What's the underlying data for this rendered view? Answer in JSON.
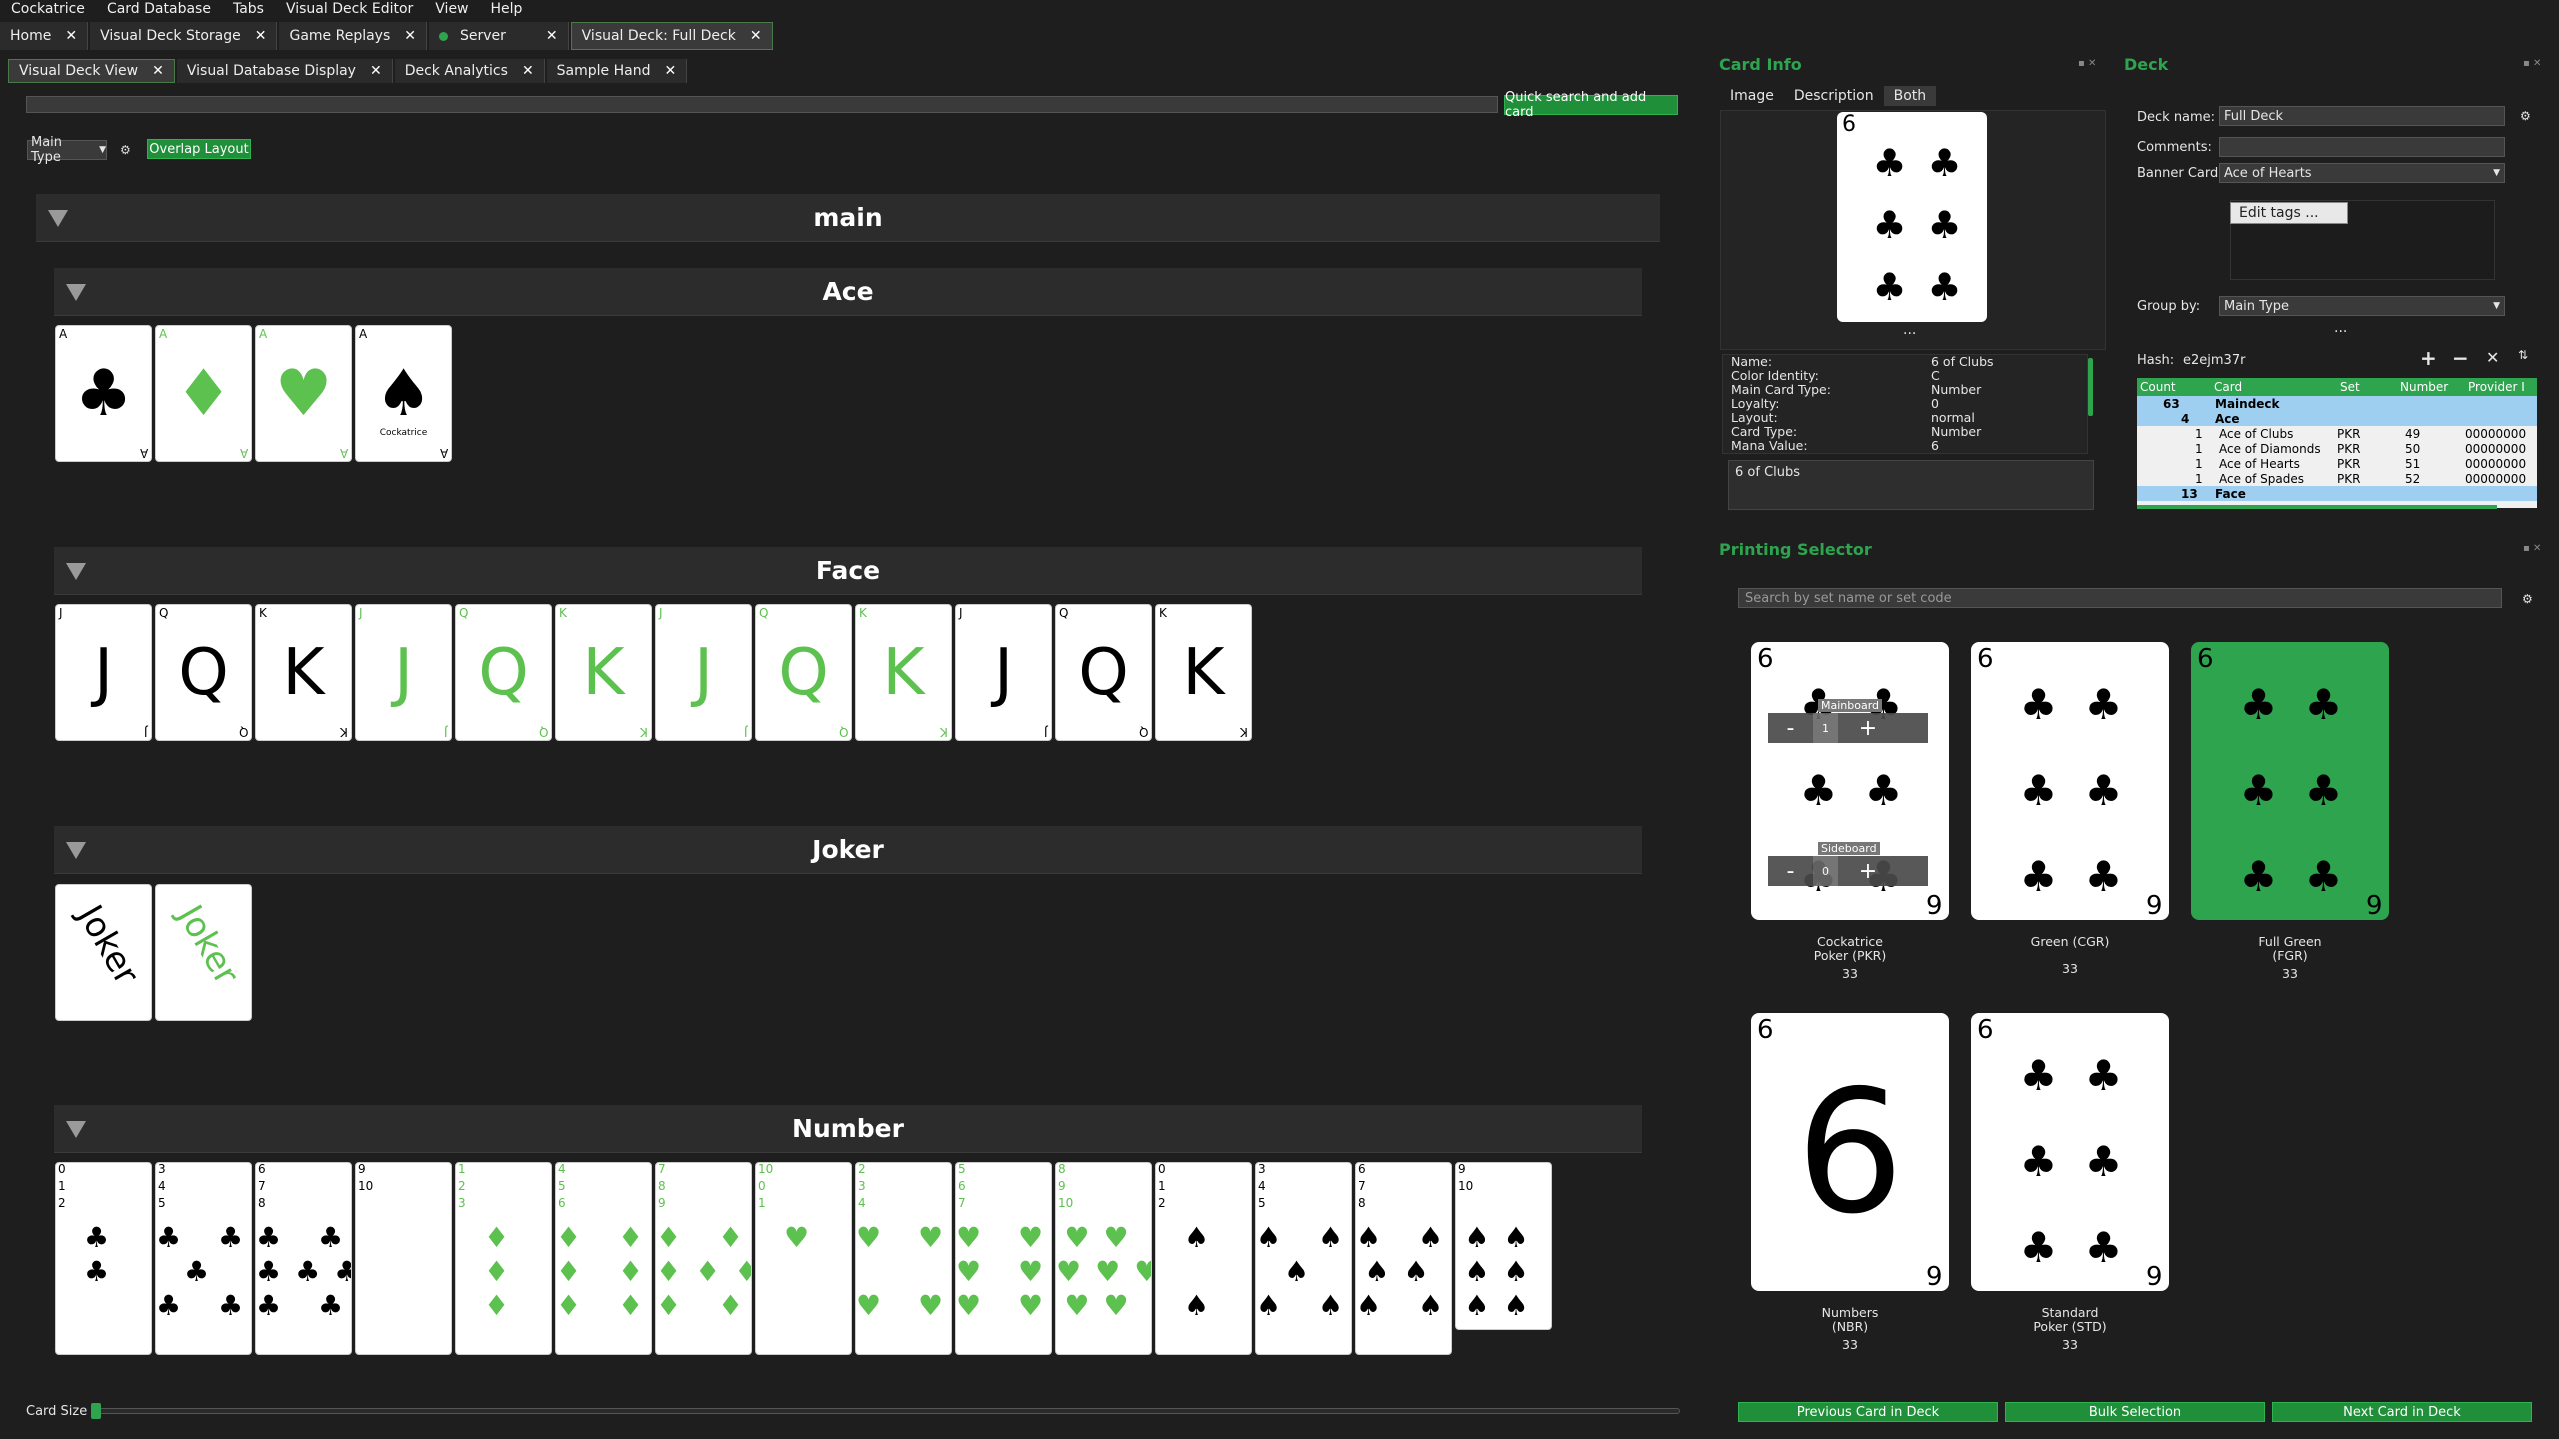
{
  "menu": [
    "Cockatrice",
    "Card Database",
    "Tabs",
    "Visual Deck Editor",
    "View",
    "Help"
  ],
  "tabs": [
    {
      "label": "Home"
    },
    {
      "label": "Visual Deck Storage"
    },
    {
      "label": "Game Replays"
    },
    {
      "label": "Server"
    },
    {
      "label": "Visual Deck: Full Deck"
    }
  ],
  "subtabs": [
    "Visual Deck View",
    "Visual Database Display",
    "Deck Analytics",
    "Sample Hand"
  ],
  "toolbar": {
    "quick_search": "Quick search and add card",
    "main_type": "Main Type",
    "overlap": "Overlap Layout"
  },
  "groups": {
    "main": "main",
    "ace": "Ace",
    "face": "Face",
    "joker": "Joker",
    "number": "Number"
  },
  "ace_cards": [
    {
      "rank": "A",
      "suit": "♣",
      "green": false
    },
    {
      "rank": "A",
      "suit": "♦",
      "green": true
    },
    {
      "rank": "A",
      "suit": "♥",
      "green": true
    },
    {
      "rank": "A",
      "suit": "♠",
      "green": false,
      "brand": "Cockatrice"
    }
  ],
  "face_cards": [
    {
      "r": "J",
      "g": false
    },
    {
      "r": "Q",
      "g": false
    },
    {
      "r": "K",
      "g": false
    },
    {
      "r": "J",
      "g": true
    },
    {
      "r": "Q",
      "g": true
    },
    {
      "r": "K",
      "g": true
    },
    {
      "r": "J",
      "g": true
    },
    {
      "r": "Q",
      "g": true
    },
    {
      "r": "K",
      "g": true
    },
    {
      "r": "J",
      "g": false
    },
    {
      "r": "Q",
      "g": false
    },
    {
      "r": "K",
      "g": false
    }
  ],
  "joker_cards": [
    {
      "label": "Joker",
      "g": false
    },
    {
      "label": "Joker",
      "g": true
    }
  ],
  "number_cards": [
    {
      "ranks": [
        "0",
        "1",
        "2"
      ],
      "suit": "♣",
      "g": false,
      "pips": "♣\n♣"
    },
    {
      "ranks": [
        "3",
        "4",
        "5"
      ],
      "suit": "♣",
      "g": false,
      "pips": "♣ ♣\n♣\n♣ ♣"
    },
    {
      "ranks": [
        "6",
        "7",
        "8"
      ],
      "suit": "♣",
      "g": false,
      "pips": "♣ ♣\n♣♣♣\n♣ ♣"
    },
    {
      "ranks": [
        "9",
        "10",
        ""
      ],
      "suit": "♣",
      "g": false,
      "pips": ""
    },
    {
      "ranks": [
        "1",
        "2",
        "3"
      ],
      "suit": "♦",
      "g": true,
      "pips": "♦\n♦\n♦"
    },
    {
      "ranks": [
        "4",
        "5",
        "6"
      ],
      "suit": "♦",
      "g": true,
      "pips": "♦ ♦\n♦ ♦\n♦ ♦"
    },
    {
      "ranks": [
        "7",
        "8",
        "9"
      ],
      "suit": "♦",
      "g": true,
      "pips": "♦ ♦\n♦♦♦\n♦ ♦"
    },
    {
      "ranks": [
        "10",
        "0",
        "1"
      ],
      "suit": "♥",
      "g": true,
      "pips": "♥"
    },
    {
      "ranks": [
        "2",
        "3",
        "4"
      ],
      "suit": "♥",
      "g": true,
      "pips": "♥ ♥\n\n♥ ♥"
    },
    {
      "ranks": [
        "5",
        "6",
        "7"
      ],
      "suit": "♥",
      "g": true,
      "pips": "♥ ♥\n♥ ♥\n♥ ♥"
    },
    {
      "ranks": [
        "8",
        "9",
        "10"
      ],
      "suit": "♥",
      "g": true,
      "pips": "♥♥\n♥♥♥\n♥♥"
    },
    {
      "ranks": [
        "0",
        "1",
        "2"
      ],
      "suit": "♠",
      "g": false,
      "pips": "♠\n\n♠"
    },
    {
      "ranks": [
        "3",
        "4",
        "5"
      ],
      "suit": "♠",
      "g": false,
      "pips": "♠ ♠\n♠\n♠ ♠"
    },
    {
      "ranks": [
        "6",
        "7",
        "8"
      ],
      "suit": "♠",
      "g": false,
      "pips": "♠ ♠\n♠♠\n♠ ♠"
    },
    {
      "ranks": [
        "9",
        "10",
        ""
      ],
      "suit": "♠",
      "g": false,
      "pips": "♠♠\n♠♠\n♠♠"
    }
  ],
  "card_size_label": "Card Size",
  "card_info": {
    "title": "Card Info",
    "tabs": [
      "Image",
      "Description",
      "Both"
    ],
    "preview_rank": "6",
    "preview_suit": "♣",
    "props": [
      [
        "Name:",
        "6 of Clubs"
      ],
      [
        "Color Identity:",
        "C"
      ],
      [
        "Main Card Type:",
        "Number"
      ],
      [
        "Loyalty:",
        "0"
      ],
      [
        "Layout:",
        "normal"
      ],
      [
        "Card Type:",
        "Number"
      ],
      [
        "Mana Value:",
        "6"
      ]
    ],
    "description": "6 of Clubs",
    "ellipsis": "..."
  },
  "deck": {
    "title": "Deck",
    "name_label": "Deck name:",
    "name_value": "Full Deck",
    "comments_label": "Comments:",
    "banner_label": "Banner Card",
    "banner_value": "Ace of Hearts",
    "edit_tags": "Edit tags ...",
    "group_label": "Group by:",
    "group_value": "Main Type",
    "hash_label": "Hash:",
    "hash_value": "e2ejm37r",
    "columns": [
      "Count",
      "Card",
      "Set",
      "Number",
      "Provider I"
    ],
    "rows": [
      {
        "type": "top",
        "count": "63",
        "name": "Maindeck"
      },
      {
        "type": "sub",
        "count": "4",
        "name": "Ace"
      },
      {
        "type": "card",
        "count": "1",
        "name": "Ace of Clubs",
        "set": "PKR",
        "num": "49",
        "prov": "00000000"
      },
      {
        "type": "card",
        "count": "1",
        "name": "Ace of Diamonds",
        "set": "PKR",
        "num": "50",
        "prov": "00000000"
      },
      {
        "type": "card",
        "count": "1",
        "name": "Ace of Hearts",
        "set": "PKR",
        "num": "51",
        "prov": "00000000"
      },
      {
        "type": "card",
        "count": "1",
        "name": "Ace of Spades",
        "set": "PKR",
        "num": "52",
        "prov": "00000000"
      },
      {
        "type": "sub",
        "count": "13",
        "name": "Face"
      }
    ]
  },
  "printing": {
    "title": "Printing Selector",
    "search_placeholder": "Search by set name or set code",
    "cards": [
      {
        "line1": "Cockatrice",
        "line2": "Poker (PKR)",
        "count": "33"
      },
      {
        "line1": "Green (CGR)",
        "line2": "",
        "count": "33"
      },
      {
        "line1": "Full Green",
        "line2": "(FGR)",
        "count": "33"
      },
      {
        "line1": "Numbers",
        "line2": "(NBR)",
        "count": "33"
      },
      {
        "line1": "Standard",
        "line2": "Poker (STD)",
        "count": "33"
      }
    ],
    "mainboard": "Mainboard",
    "sideboard": "Sideboard",
    "main_count": "1",
    "side_count": "0",
    "prev": "Previous Card in Deck",
    "bulk": "Bulk Selection",
    "next": "Next Card in Deck"
  },
  "colors": {
    "accent": "#2ea44f",
    "bg": "#1e1e1e",
    "green_card": "#5dc14f"
  }
}
